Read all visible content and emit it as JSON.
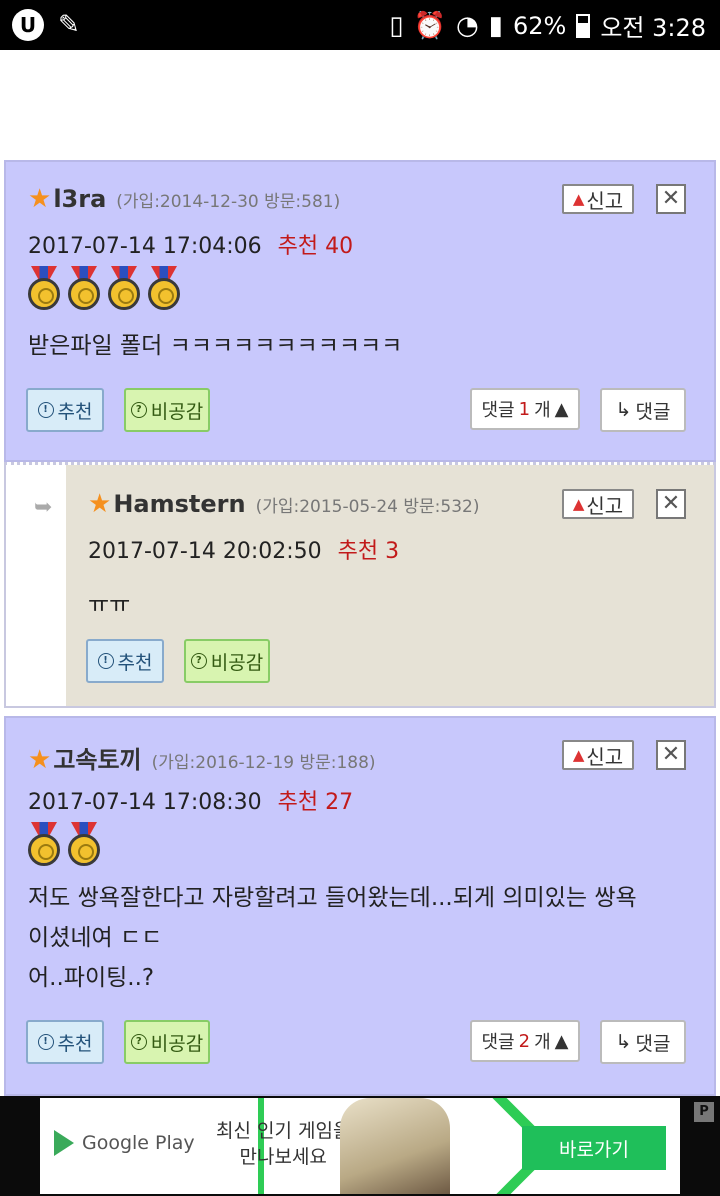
{
  "status_bar": {
    "battery": "62%",
    "time_label": "오전 3:28",
    "icons": [
      "u-plus-icon",
      "feather-icon",
      "vibrate-icon",
      "alarm-icon",
      "wifi-icon",
      "signal-icon",
      "battery-icon"
    ]
  },
  "comments": [
    {
      "author": "l3ra",
      "meta": "(가입:2014-12-30 방문:581)",
      "datetime": "2017-07-14 17:04:06",
      "rec_label": "추천 40",
      "medal_count": 4,
      "body": [
        "받은파일 폴더 ㅋㅋㅋㅋㅋㅋㅋㅋㅋㅋㅋ"
      ],
      "reply_count_label": "댓글",
      "reply_count": "1",
      "reply_count_suffix": "개"
    },
    {
      "author": "Hamstern",
      "meta": "(가입:2015-05-24 방문:532)",
      "datetime": "2017-07-14 20:02:50",
      "rec_label": "추천 3",
      "body": [
        "ㅠㅠ"
      ]
    },
    {
      "author": "고속토끼",
      "meta": "(가입:2016-12-19 방문:188)",
      "datetime": "2017-07-14 17:08:30",
      "rec_label": "추천 27",
      "medal_count": 2,
      "body": [
        "저도 쌍욕잘한다고 자랑할려고 들어왔는데...되게 의미있는 쌍욕",
        "이셨네여 ㄷㄷ",
        "어..파이팅..?"
      ],
      "reply_count_label": "댓글",
      "reply_count": "2",
      "reply_count_suffix": "개"
    }
  ],
  "buttons": {
    "report": "신고",
    "like": "추천",
    "dislike": "비공감",
    "reply": "댓글"
  },
  "ad": {
    "store": "Google Play",
    "text_line1": "최신 인기 게임을",
    "text_line2": "만나보세요",
    "cta": "바로가기"
  },
  "colors": {
    "comment_bg": "#c8c8fc",
    "reply_bg": "#e6e2d6",
    "star": "#f5901e",
    "recommend": "#c21a1a"
  }
}
